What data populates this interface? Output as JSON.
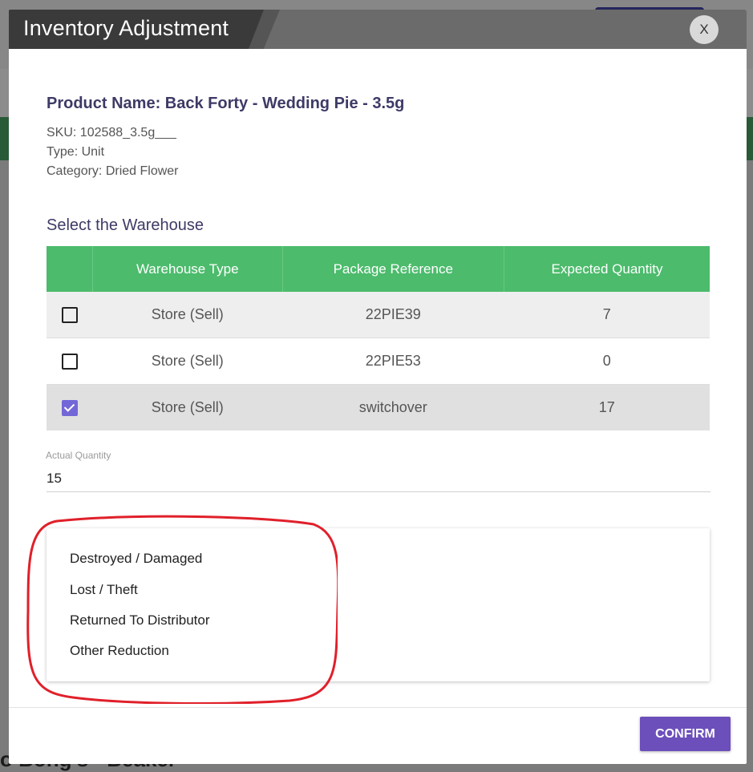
{
  "modal": {
    "title": "Inventory Adjustment",
    "close_label": "X"
  },
  "product": {
    "name": "Product Name: Back Forty - Wedding Pie - 3.5g",
    "sku": "SKU: 102588_3.5g___",
    "type": "Type: Unit",
    "category": "Category: Dried Flower"
  },
  "warehouse": {
    "section_title": "Select the Warehouse",
    "columns": [
      "",
      "Warehouse Type",
      "Package Reference",
      "Expected Quantity"
    ],
    "rows": [
      {
        "checked": false,
        "type": "Store (Sell)",
        "package": "22PIE39",
        "expected": "7"
      },
      {
        "checked": false,
        "type": "Store (Sell)",
        "package": "22PIE53",
        "expected": "0"
      },
      {
        "checked": true,
        "type": "Store (Sell)",
        "package": "switchover",
        "expected": "17"
      }
    ]
  },
  "actual_quantity": {
    "label": "Actual Quantity",
    "value": "15"
  },
  "reason_dropdown": {
    "options": [
      "Destroyed / Damaged",
      "Lost / Theft",
      "Returned To Distributor",
      "Other Reduction"
    ]
  },
  "footer": {
    "confirm_label": "CONFIRM"
  },
  "background": {
    "partial_text": "o Bong's - Beaker"
  },
  "colors": {
    "header_green": "#4cbb6c",
    "primary": "#6c4fbb",
    "annotation_red": "#e0202a"
  }
}
